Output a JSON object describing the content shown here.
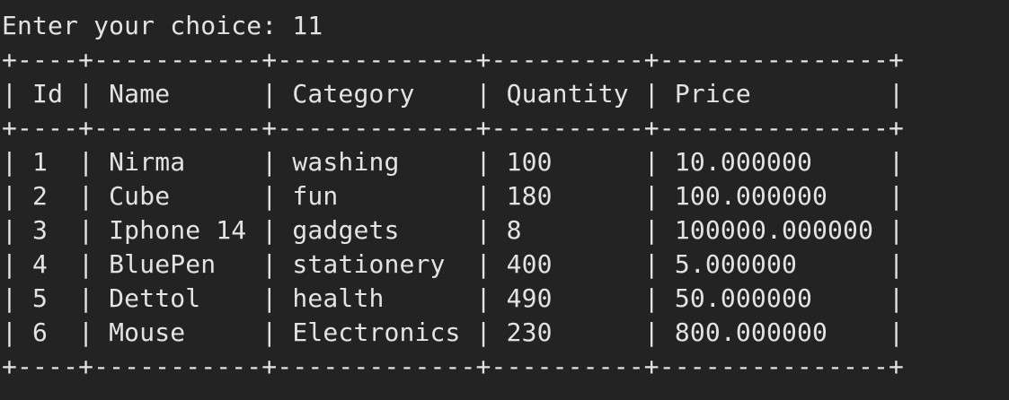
{
  "terminal": {
    "prompt_label": "Enter your choice: ",
    "prompt_value": "11",
    "border": "+----+-----------+-------------+----------+---------------+",
    "columns": [
      "Id",
      "Name",
      "Category",
      "Quantity",
      "Price"
    ],
    "rows": [
      [
        "1",
        "Nirma",
        "washing",
        "100",
        "10.000000"
      ],
      [
        "2",
        "Cube",
        "fun",
        "180",
        "100.000000"
      ],
      [
        "3",
        "Iphone 14",
        "gadgets",
        "8",
        "100000.000000"
      ],
      [
        "4",
        "BluePen",
        "stationery",
        "400",
        "5.000000"
      ],
      [
        "5",
        "Dettol",
        "health",
        "490",
        "50.000000"
      ],
      [
        "6",
        "Mouse",
        "Electronics",
        "230",
        "800.000000"
      ]
    ]
  },
  "colors": {
    "background": "#232323",
    "text": "#e3e3e3"
  }
}
